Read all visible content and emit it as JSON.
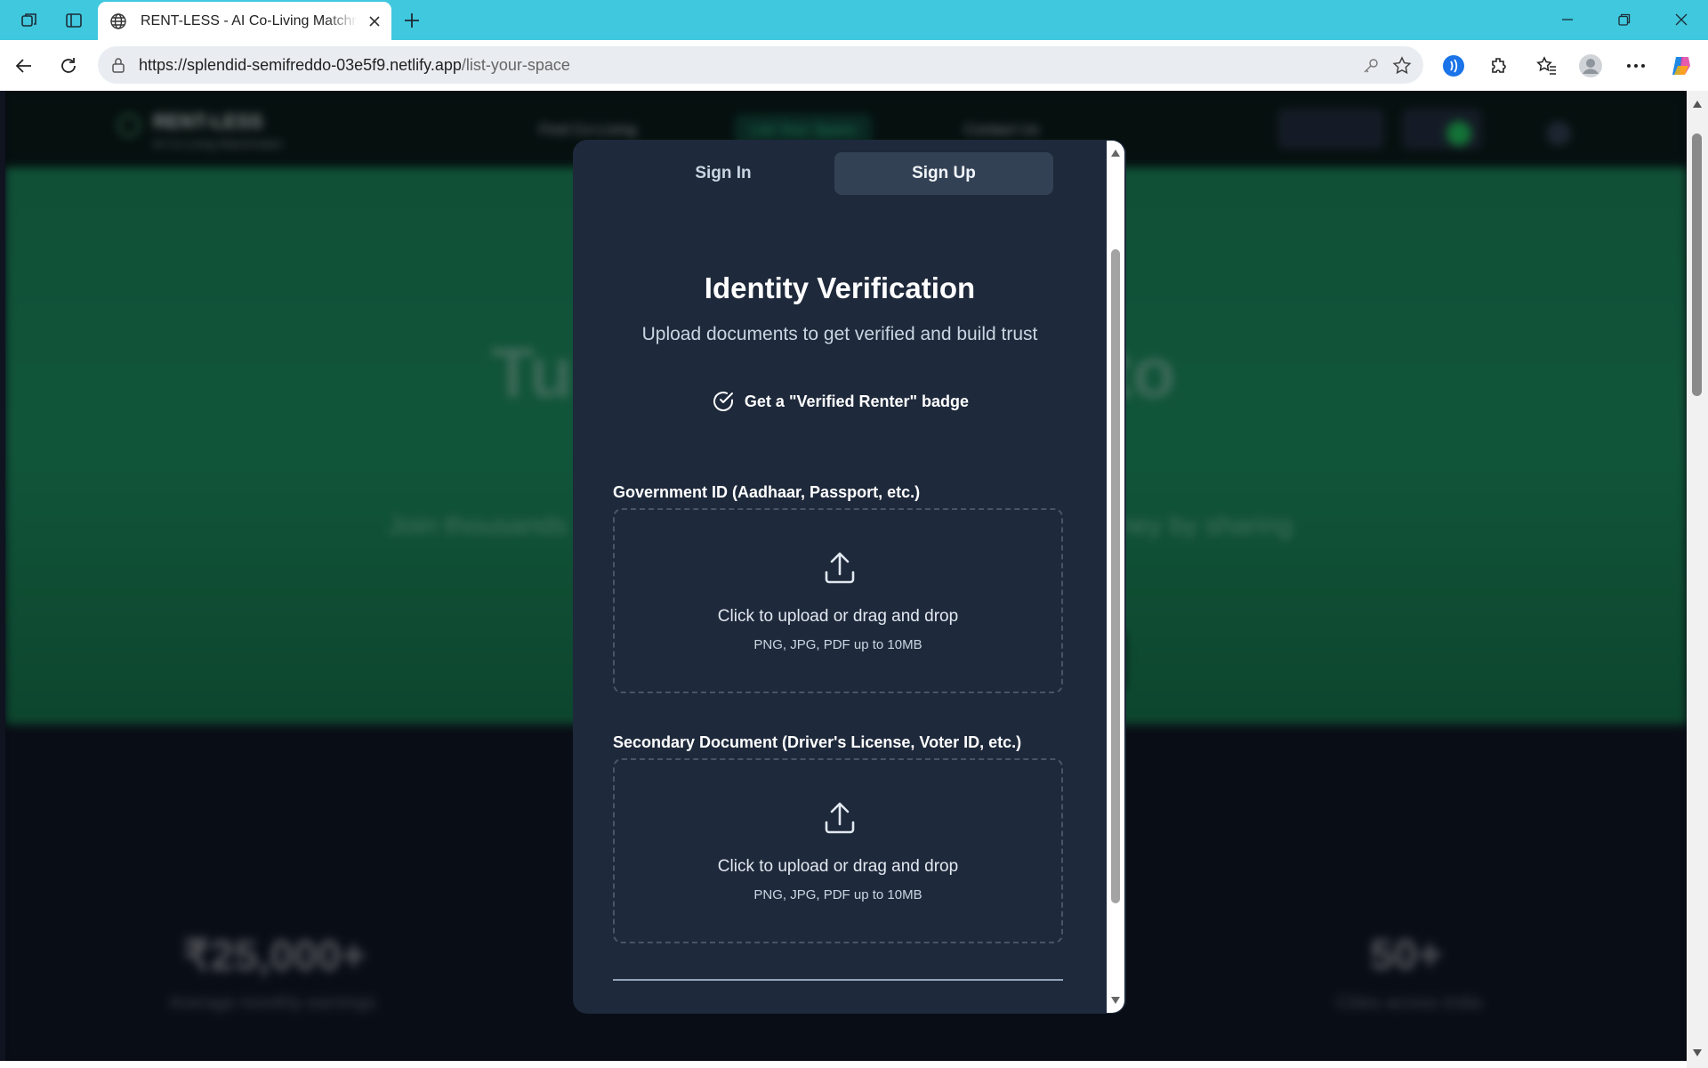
{
  "browser": {
    "tab_title": "RENT-LESS - AI Co-Living Matchmaking",
    "url_host": "https://splendid-semifreddo-03e5f9.netlify.app",
    "url_path": "/list-your-space"
  },
  "background_page": {
    "brand": "RENT-LESS",
    "tagline": "AI Co-Living Matchmaker",
    "nav": [
      "Find Co-Living",
      "List Your Space",
      "Contact Us"
    ],
    "hero_title_left": "Tu",
    "hero_title_right": "to",
    "hero_sub_left": "Join thousands",
    "hero_sub_right": "ney by sharing",
    "stats": [
      {
        "value": "₹25,000+",
        "label": "Average monthly earnings"
      },
      {
        "value": "50+",
        "label": "Cities across India"
      }
    ]
  },
  "modal": {
    "tabs": [
      {
        "label": "Sign In",
        "active": false
      },
      {
        "label": "Sign Up",
        "active": true
      }
    ],
    "title": "Identity Verification",
    "subtitle": "Upload documents to get verified and build trust",
    "badge_text": "Get a \"Verified Renter\" badge",
    "uploads": [
      {
        "label": "Government ID (Aadhaar, Passport, etc.)",
        "primary": "Click to upload or drag and drop",
        "hint": "PNG, JPG, PDF up to 10MB"
      },
      {
        "label": "Secondary Document (Driver's License, Voter ID, etc.)",
        "primary": "Click to upload or drag and drop",
        "hint": "PNG, JPG, PDF up to 10MB"
      }
    ]
  },
  "icons": {
    "badge": "check-circle-icon",
    "upload": "upload-icon"
  },
  "colors": {
    "tabbar": "#3fc8de",
    "modal_bg": "#1e293b",
    "active_tab_bg": "#334155",
    "hero_green": "#1d9364"
  }
}
